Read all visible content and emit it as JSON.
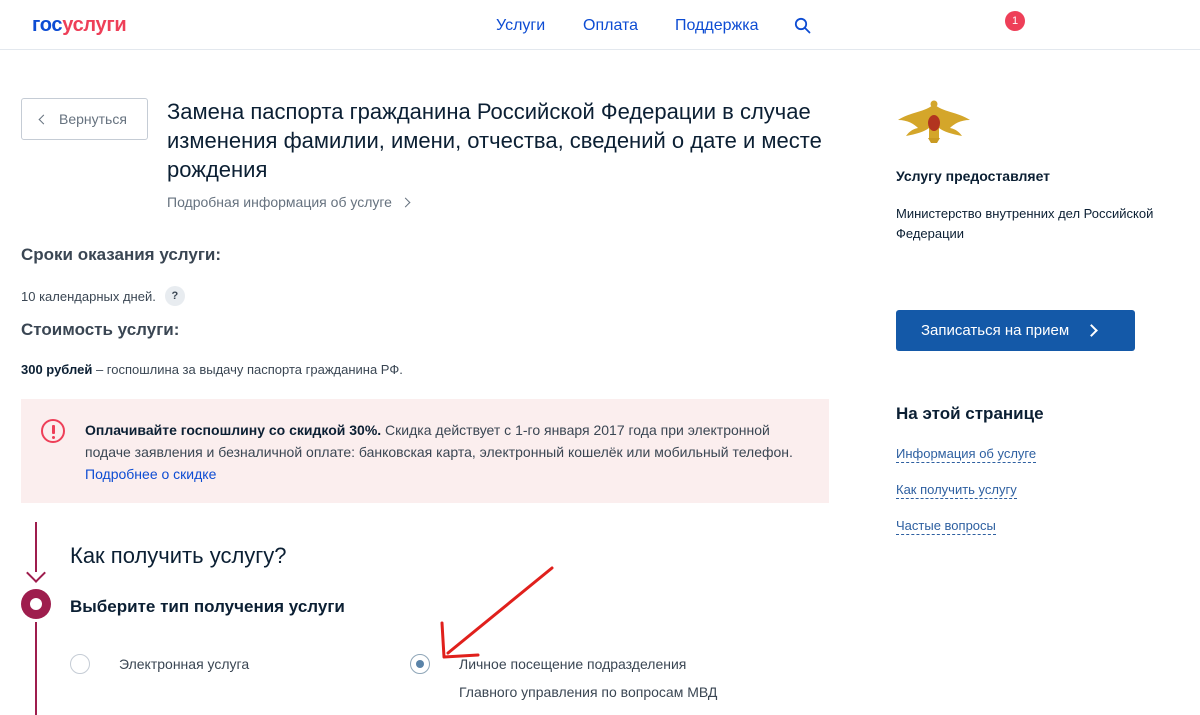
{
  "header": {
    "logo_gos": "гос",
    "logo_uslugi": "услуги",
    "nav": [
      "Услуги",
      "Оплата",
      "Поддержка"
    ],
    "search_icon": "search-icon",
    "notification_count": "1"
  },
  "main": {
    "back_label": "Вернуться",
    "title": "Замена паспорта гражданина Российской Федерации в случае изменения фамилии, имени, отчества, сведений о дате и месте рождения",
    "more_info": "Подробная информация об услуге",
    "terms_title": "Сроки оказания услуги:",
    "terms_text": "10 календарных дней.",
    "help_icon": "?",
    "cost_title": "Стоимость услуги:",
    "cost_amount": "300 рублей",
    "cost_rest": " – госпошлина за выдачу паспорта гражданина РФ."
  },
  "alert": {
    "bold": "Оплачивайте госпошлину со скидкой 30%.",
    "text": " Скидка действует с 1-го января 2017 года при электронной подаче заявления и безналичной оплате: банковская карта, электронный кошелёк или мобильный телефон. ",
    "link": "Подробнее о скидке"
  },
  "how": {
    "title": "Как получить услугу?",
    "choose_title": "Выберите тип получения услуги",
    "option_electronic": "Электронная услуга",
    "option_personal": "Личное посещение подразделения Главного управления по вопросам МВД",
    "selected": "option_personal"
  },
  "sidebar": {
    "provider_title": "Услугу предоставляет",
    "provider_name": "Министерство внутренних дел Российской Федерации",
    "book_button": "Записаться на прием",
    "onpage_title": "На этой странице",
    "links": [
      "Информация об услуге",
      "Как получить услугу",
      "Частые вопросы"
    ]
  },
  "colors": {
    "brand_blue": "#0d4cd3",
    "brand_red": "#ee3f58",
    "stepper": "#9e1d4d",
    "alert_bg": "#fbeeee",
    "annotation_arrow": "#e0201c"
  }
}
